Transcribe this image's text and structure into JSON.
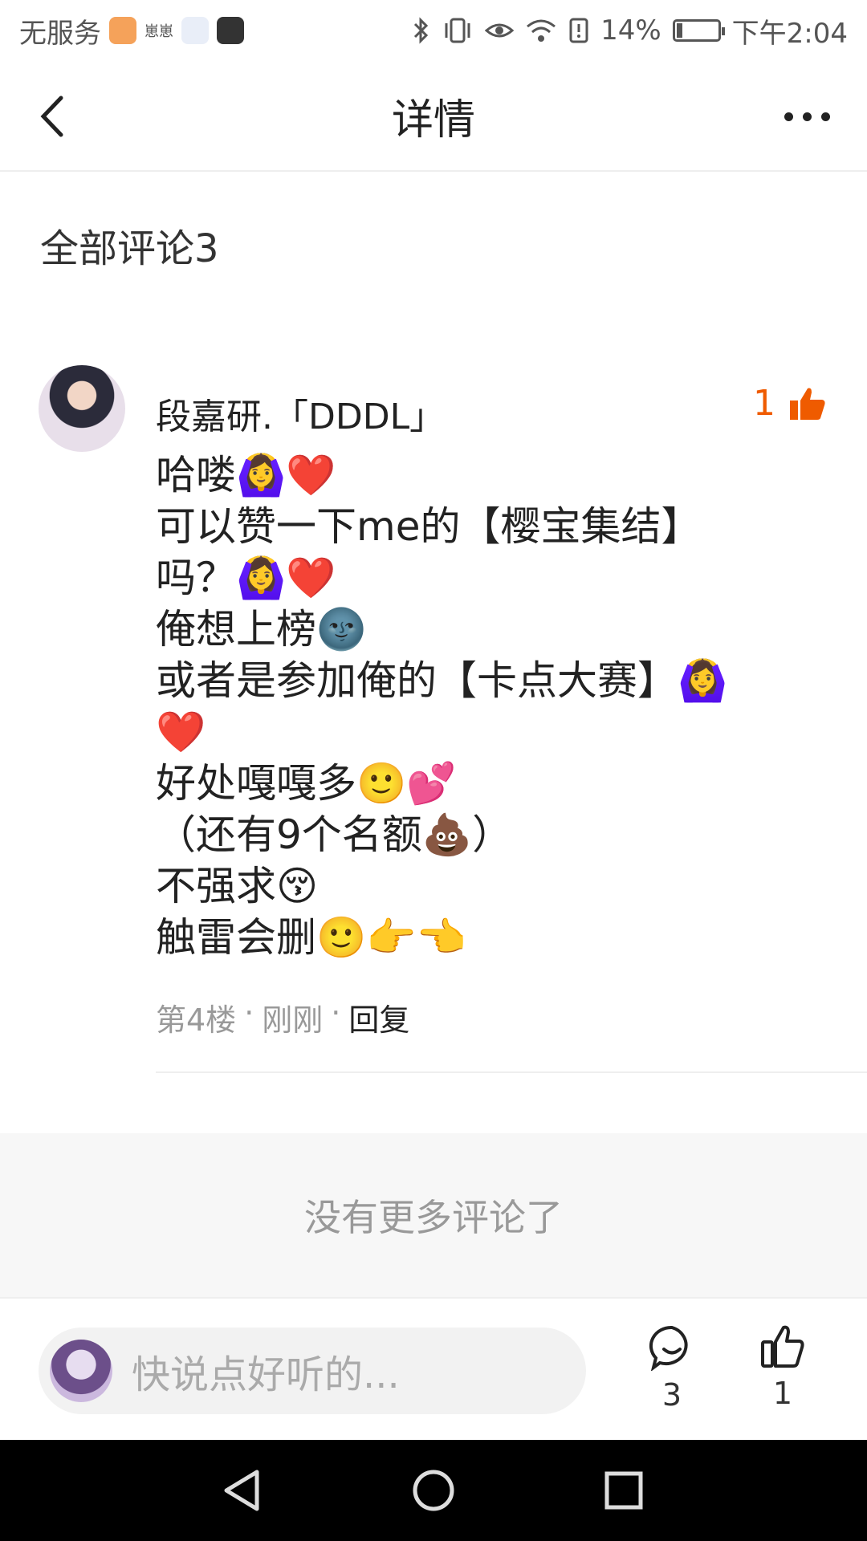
{
  "status_bar": {
    "carrier": "无服务",
    "app_icon_texts": [
      "崽崽"
    ],
    "battery_percent": "14%",
    "battery_level": 0.14,
    "time": "下午2:04"
  },
  "header": {
    "title": "详情"
  },
  "comments_section": {
    "title": "全部评论3"
  },
  "comment": {
    "username": "段嘉研.「DDDL」",
    "like_count": "1",
    "lines": [
      "哈喽🙆‍♀️❤️",
      "可以赞一下me的【樱宝集结】",
      "吗？🙆‍♀️❤️",
      "俺想上榜🌚",
      "或者是参加俺的【卡点大赛】🙆‍♀️",
      "❤️",
      "好处嘎嘎多🙂💕",
      "（还有9个名额💩）",
      "不强求😚",
      "触雷会删🙂👉👈"
    ],
    "floor": "第4楼",
    "time": "刚刚",
    "separator": "·",
    "reply_label": "回复"
  },
  "no_more": {
    "text": "没有更多评论了"
  },
  "input_bar": {
    "placeholder": "快说点好听的...",
    "comment_count": "3",
    "like_count": "1"
  },
  "colors": {
    "accent": "#EF5B00",
    "text": "#222222",
    "muted": "#999999"
  }
}
